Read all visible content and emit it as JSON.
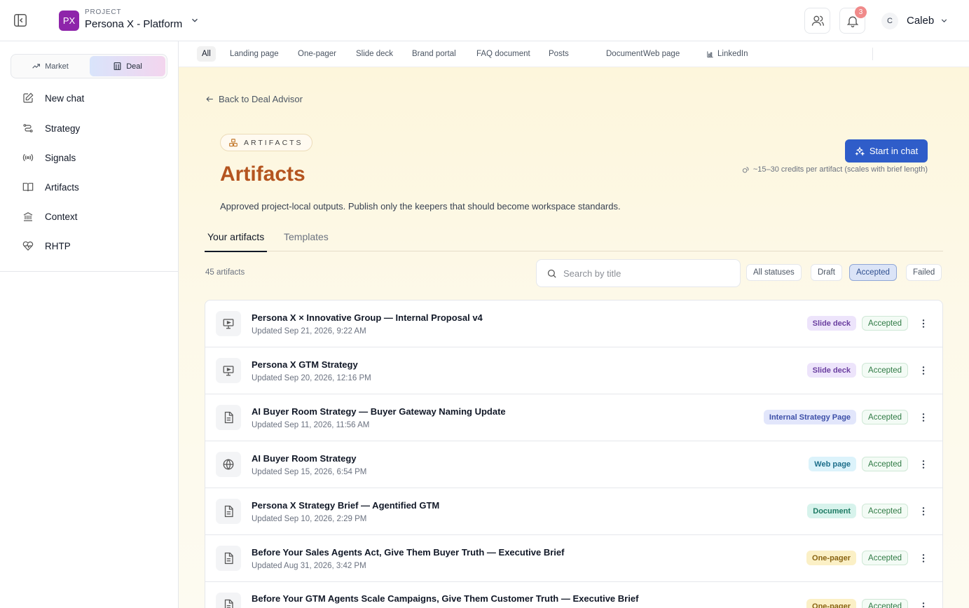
{
  "header": {
    "project_badge": "PX",
    "project_label": "PROJECT",
    "project_name": "Persona X - Platform",
    "notification_count": "3",
    "user_initial": "C",
    "user_name": "Caleb"
  },
  "sidebar": {
    "segments": [
      {
        "label": "Market",
        "icon": "trending-up-icon",
        "active": false
      },
      {
        "label": "Deal",
        "icon": "building-icon",
        "active": true
      }
    ],
    "items": [
      {
        "label": "New chat",
        "icon": "edit-icon"
      },
      {
        "label": "Strategy",
        "icon": "route-icon"
      },
      {
        "label": "Signals",
        "icon": "radio-signal-icon"
      },
      {
        "label": "Artifacts",
        "icon": "book-icon"
      },
      {
        "label": "Context",
        "icon": "landmark-icon"
      },
      {
        "label": "RHTP",
        "icon": "heart-pulse-icon"
      }
    ]
  },
  "filterbar": {
    "chips": [
      {
        "label": "All",
        "active": true
      },
      {
        "label": "Landing page"
      },
      {
        "label": "One-pager"
      },
      {
        "label": "Slide deck"
      },
      {
        "label": "Brand portal"
      },
      {
        "label": "FAQ document"
      },
      {
        "label": "Posts"
      },
      {
        "label": "Document"
      },
      {
        "label": "Web page"
      },
      {
        "label": "LinkedIn",
        "icon": "bar-chart-icon"
      }
    ]
  },
  "main": {
    "back_label": "Back to Deal Advisor",
    "badge_label": "ARTIFACTS",
    "title": "Artifacts",
    "description": "Approved project-local outputs. Publish only the keepers that should become workspace standards.",
    "start_button": "Start in chat",
    "credits_note": "~15–30 credits per artifact (scales with brief length)",
    "tabs": [
      {
        "label": "Your artifacts",
        "active": true
      },
      {
        "label": "Templates",
        "active": false
      }
    ],
    "count_label": "45 artifacts",
    "search_placeholder": "Search by title",
    "status_filters": [
      {
        "label": "All statuses",
        "active": false
      },
      {
        "label": "Draft",
        "active": false
      },
      {
        "label": "Accepted",
        "active": true
      },
      {
        "label": "Failed",
        "active": false
      }
    ],
    "rows": [
      {
        "title": "Persona X × Innovative Group — Internal Proposal v4",
        "updated": "Updated Sep 21, 2026, 9:22 AM",
        "type": "Slide deck",
        "status": "Accepted",
        "icon": "presentation-icon"
      },
      {
        "title": "Persona X GTM Strategy",
        "updated": "Updated Sep 20, 2026, 12:16 PM",
        "type": "Slide deck",
        "status": "Accepted",
        "icon": "presentation-icon"
      },
      {
        "title": "AI Buyer Room Strategy — Buyer Gateway Naming Update",
        "updated": "Updated Sep 11, 2026, 11:56 AM",
        "type": "Internal Strategy Page",
        "status": "Accepted",
        "icon": "document-icon"
      },
      {
        "title": "AI Buyer Room Strategy",
        "updated": "Updated Sep 15, 2026, 6:54 PM",
        "type": "Web page",
        "status": "Accepted",
        "icon": "globe-icon"
      },
      {
        "title": "Persona X Strategy Brief — Agentified GTM",
        "updated": "Updated Sep 10, 2026, 2:29 PM",
        "type": "Document",
        "status": "Accepted",
        "icon": "document-icon"
      },
      {
        "title": "Before Your Sales Agents Act, Give Them Buyer Truth — Executive Brief",
        "updated": "Updated Aug 31, 2026, 3:42 PM",
        "type": "One-pager",
        "status": "Accepted",
        "icon": "document-icon"
      },
      {
        "title": "Before Your GTM Agents Scale Campaigns, Give Them Customer Truth — Executive Brief",
        "updated": "",
        "type": "One-pager",
        "status": "Accepted",
        "icon": "document-icon"
      }
    ]
  }
}
